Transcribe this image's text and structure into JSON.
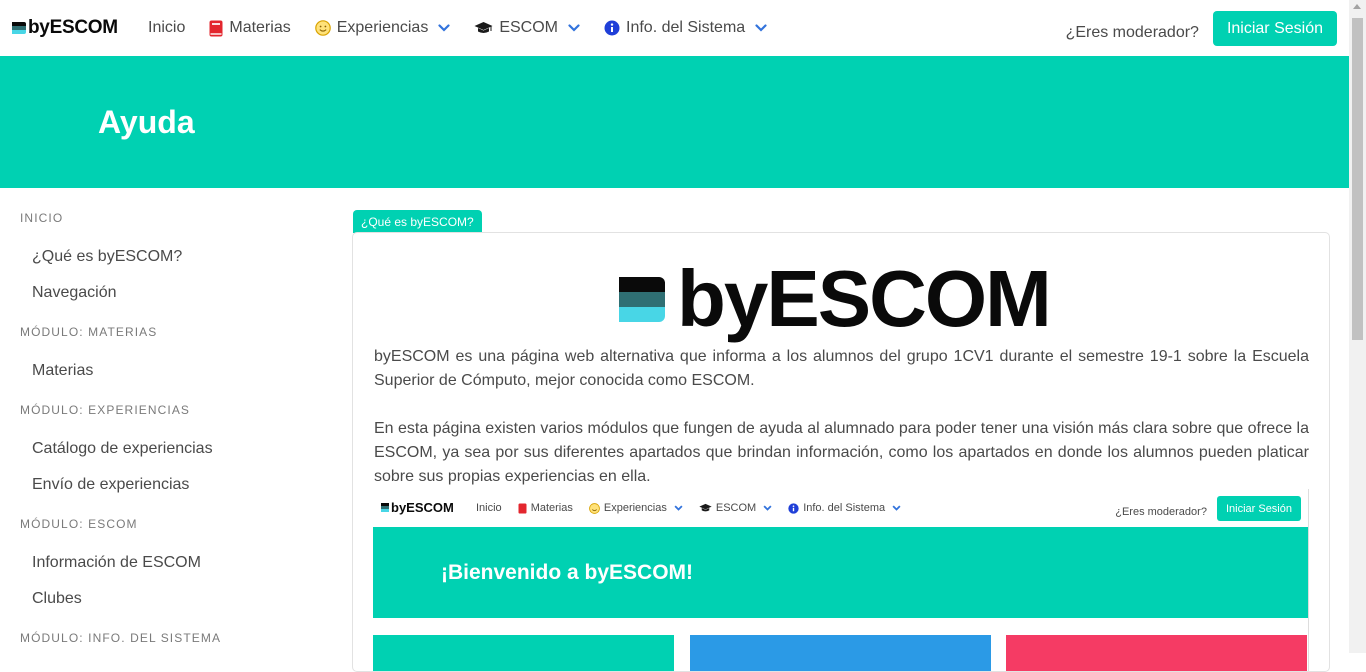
{
  "navbar": {
    "brand": "byESCOM",
    "items": [
      {
        "label": "Inicio"
      },
      {
        "label": "Materias"
      },
      {
        "label": "Experiencias"
      },
      {
        "label": "ESCOM"
      },
      {
        "label": "Info. del Sistema"
      }
    ],
    "moderator_text": "¿Eres moderador?",
    "login_label": "Iniciar Sesión"
  },
  "hero": {
    "title": "Ayuda"
  },
  "sidebar": {
    "sections": [
      {
        "label": "INICIO",
        "links": [
          "¿Qué es byESCOM?",
          "Navegación"
        ]
      },
      {
        "label": "MÓDULO: MATERIAS",
        "links": [
          "Materias"
        ]
      },
      {
        "label": "MÓDULO: EXPERIENCIAS",
        "links": [
          "Catálogo de experiencias",
          "Envío de experiencias"
        ]
      },
      {
        "label": "MÓDULO: ESCOM",
        "links": [
          "Información de ESCOM",
          "Clubes"
        ]
      },
      {
        "label": "MÓDULO: INFO. DEL SISTEMA",
        "links": []
      }
    ]
  },
  "main": {
    "tag": "¿Qué es byESCOM?",
    "logo_text": "byESCOM",
    "paragraph1": "byESCOM es una página web alternativa que informa a los alumnos del grupo 1CV1 durante el semestre 19-1 sobre la Escuela Superior de Cómputo, mejor conocida como ESCOM.",
    "paragraph2": "En esta página existen varios módulos que fungen de ayuda al alumnado para poder tener una visión más clara sobre que ofrece la ESCOM, ya sea por sus diferentes apartados que brindan información, como los apartados en donde los alumnos pueden platicar sobre sus propias experiencias en ella.",
    "screenshot": {
      "brand": "byESCOM",
      "items": [
        "Inicio",
        "Materias",
        "Experiencias",
        "ESCOM",
        "Info. del Sistema"
      ],
      "moderator_text": "¿Eres moderador?",
      "login_label": "Iniciar Sesión",
      "hero_title": "¡Bienvenido a byESCOM!"
    }
  },
  "colors": {
    "primary": "#00d1b2",
    "logo_top": "#2f6f73",
    "logo_bottom": "#48d6e6",
    "card_blue": "#2b9ae6",
    "card_red": "#f53b64"
  },
  "icons": [
    "book-icon",
    "smile-icon",
    "graduation-cap-icon",
    "info-circle-icon",
    "chevron-down-icon"
  ]
}
